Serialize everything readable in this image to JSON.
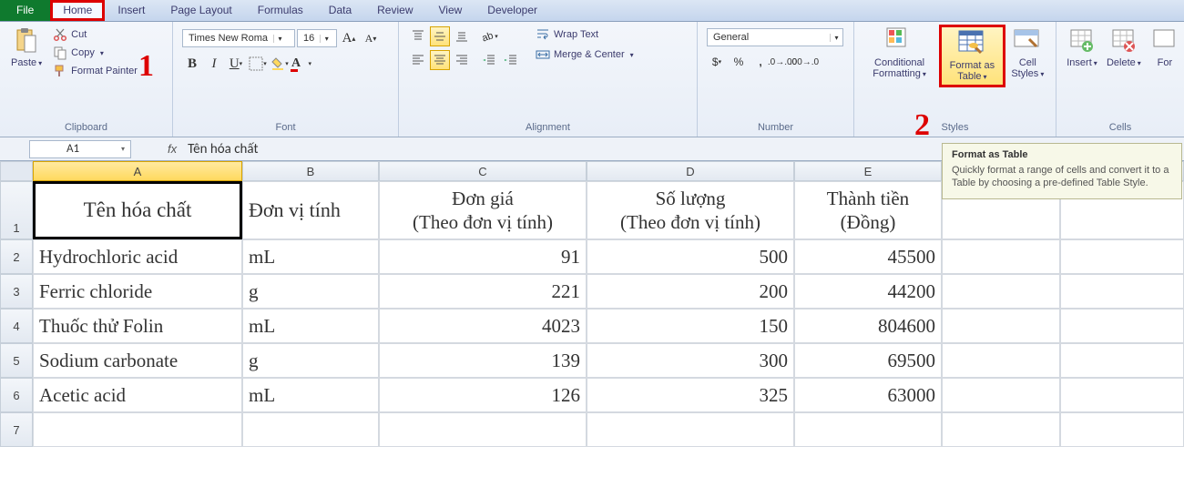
{
  "menu": {
    "tabs": [
      "File",
      "Home",
      "Insert",
      "Page Layout",
      "Formulas",
      "Data",
      "Review",
      "View",
      "Developer"
    ]
  },
  "ribbon": {
    "clipboard": {
      "label": "Clipboard",
      "paste": "Paste",
      "cut": "Cut",
      "copy": "Copy",
      "formatPainter": "Format Painter"
    },
    "font": {
      "label": "Font",
      "name": "Times New Roma",
      "size": "16"
    },
    "alignment": {
      "label": "Alignment",
      "wrap": "Wrap Text",
      "merge": "Merge & Center"
    },
    "number": {
      "label": "Number",
      "format": "General"
    },
    "styles": {
      "label": "Styles",
      "conditional": "Conditional Formatting",
      "formatTable": "Format as Table",
      "cellStyles": "Cell Styles"
    },
    "cells": {
      "label": "Cells",
      "insert": "Insert",
      "delete": "Delete",
      "format": "For"
    }
  },
  "annotations": {
    "one": "1",
    "two": "2"
  },
  "tooltip": {
    "title": "Format as Table",
    "body": "Quickly format a range of cells and convert it to a Table by choosing a pre-defined Table Style."
  },
  "formulaBar": {
    "nameBox": "A1",
    "fx": "fx",
    "formula": "Tên hóa chất"
  },
  "columns": [
    "A",
    "B",
    "C",
    "D",
    "E"
  ],
  "rowNums": [
    "1",
    "2",
    "3",
    "4",
    "5",
    "6",
    "7"
  ],
  "headers": {
    "A": "Tên hóa chất",
    "B": "Đơn vị tính",
    "C": "Đơn giá\n(Theo đơn vị tính)",
    "D": "Số lượng\n(Theo đơn vị tính)",
    "E": "Thành tiền\n(Đồng)"
  },
  "rows": [
    {
      "A": "Hydrochloric acid",
      "B": "mL",
      "C": "91",
      "D": "500",
      "E": "45500"
    },
    {
      "A": "Ferric chloride",
      "B": "g",
      "C": "221",
      "D": "200",
      "E": "44200"
    },
    {
      "A": "Thuốc thử Folin",
      "B": "mL",
      "C": "4023",
      "D": "150",
      "E": "804600"
    },
    {
      "A": "Sodium carbonate",
      "B": "g",
      "C": "139",
      "D": "300",
      "E": "69500"
    },
    {
      "A": "Acetic acid",
      "B": "mL",
      "C": "126",
      "D": "325",
      "E": "63000"
    }
  ]
}
